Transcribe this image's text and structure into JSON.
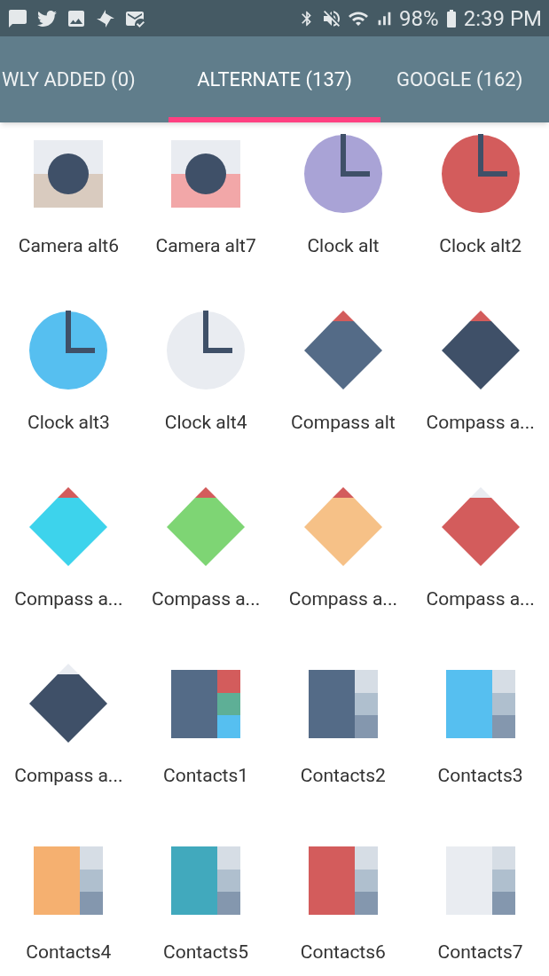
{
  "status_bar": {
    "battery": "98%",
    "time": "2:39 PM"
  },
  "tabs": [
    {
      "label": "WLY ADDED (0)",
      "selected": false
    },
    {
      "label": "ALTERNATE (137)",
      "selected": true
    },
    {
      "label": "GOOGLE (162)",
      "selected": false
    }
  ],
  "icons": [
    {
      "label": "Camera alt6",
      "kind": "camera",
      "color": "#d9cbbf"
    },
    {
      "label": "Camera alt7",
      "kind": "camera",
      "color": "#f2a7a8"
    },
    {
      "label": "Clock alt",
      "kind": "clock",
      "color": "#a9a3d6"
    },
    {
      "label": "Clock alt2",
      "kind": "clock",
      "color": "#d35c5c"
    },
    {
      "label": "Clock alt3",
      "kind": "clock",
      "color": "#56bff0"
    },
    {
      "label": "Clock alt4",
      "kind": "clock",
      "color": "#e9ecf1"
    },
    {
      "label": "Compass alt",
      "kind": "compass",
      "color": "#546b87"
    },
    {
      "label": "Compass a...",
      "kind": "compass",
      "color": "#3f5068"
    },
    {
      "label": "Compass a...",
      "kind": "compass",
      "color": "#3dd3ec"
    },
    {
      "label": "Compass a...",
      "kind": "compass",
      "color": "#7ed574"
    },
    {
      "label": "Compass a...",
      "kind": "compass",
      "color": "#f6c187"
    },
    {
      "label": "Compass a...",
      "kind": "compass_light",
      "color": "#d35c5c"
    },
    {
      "label": "Compass a...",
      "kind": "compass_light",
      "color": "#3f5068"
    },
    {
      "label": "Contacts1",
      "kind": "contacts_colored",
      "color": "#546b87"
    },
    {
      "label": "Contacts2",
      "kind": "contacts",
      "color": "#546b87"
    },
    {
      "label": "Contacts3",
      "kind": "contacts",
      "color": "#56bff0"
    },
    {
      "label": "Contacts4",
      "kind": "contacts",
      "color": "#f5b070"
    },
    {
      "label": "Contacts5",
      "kind": "contacts",
      "color": "#41a9bd"
    },
    {
      "label": "Contacts6",
      "kind": "contacts",
      "color": "#d35c5c"
    },
    {
      "label": "Contacts7",
      "kind": "contacts",
      "color": "#e9ecf1"
    }
  ]
}
